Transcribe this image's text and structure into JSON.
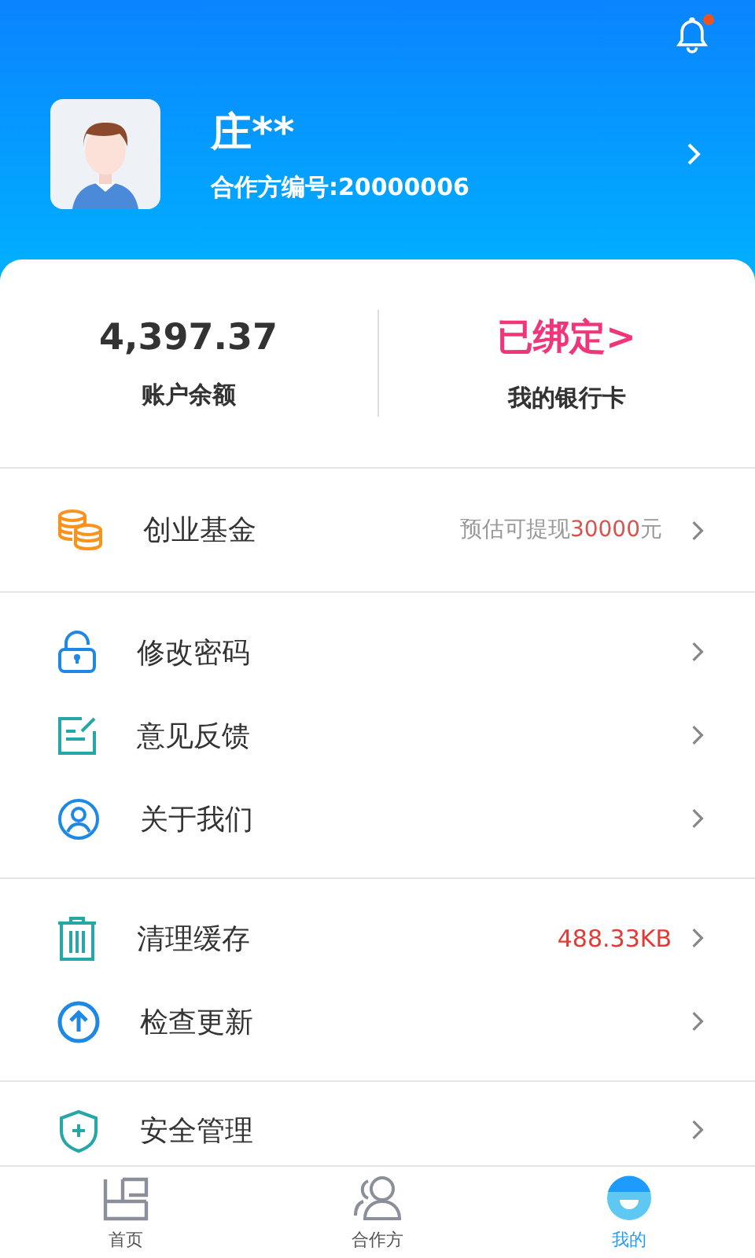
{
  "header": {
    "has_unread": true,
    "name": "庄**",
    "partner_id": "合作方编号:20000006"
  },
  "account": {
    "balance": "4,397.37",
    "balance_label": "账户余额",
    "bank_status": "已绑定>",
    "bank_label": "我的银行卡"
  },
  "menu_groups": [
    {
      "rows": [
        {
          "label": "创业基金",
          "note_prefix": "预估可提现",
          "note_amount": "30000",
          "note_suffix": "元"
        }
      ]
    },
    {
      "rows": [
        {
          "label": "修改密码"
        },
        {
          "label": "意见反馈"
        },
        {
          "label": "关于我们"
        }
      ]
    },
    {
      "rows": [
        {
          "label": "清理缓存",
          "value": "488.33KB"
        },
        {
          "label": "检查更新"
        }
      ]
    },
    {
      "rows": [
        {
          "label": "安全管理"
        }
      ]
    }
  ],
  "tabs": [
    {
      "label": "首页",
      "selected": false
    },
    {
      "label": "合作方",
      "selected": false
    },
    {
      "label": "我的",
      "selected": true
    }
  ]
}
